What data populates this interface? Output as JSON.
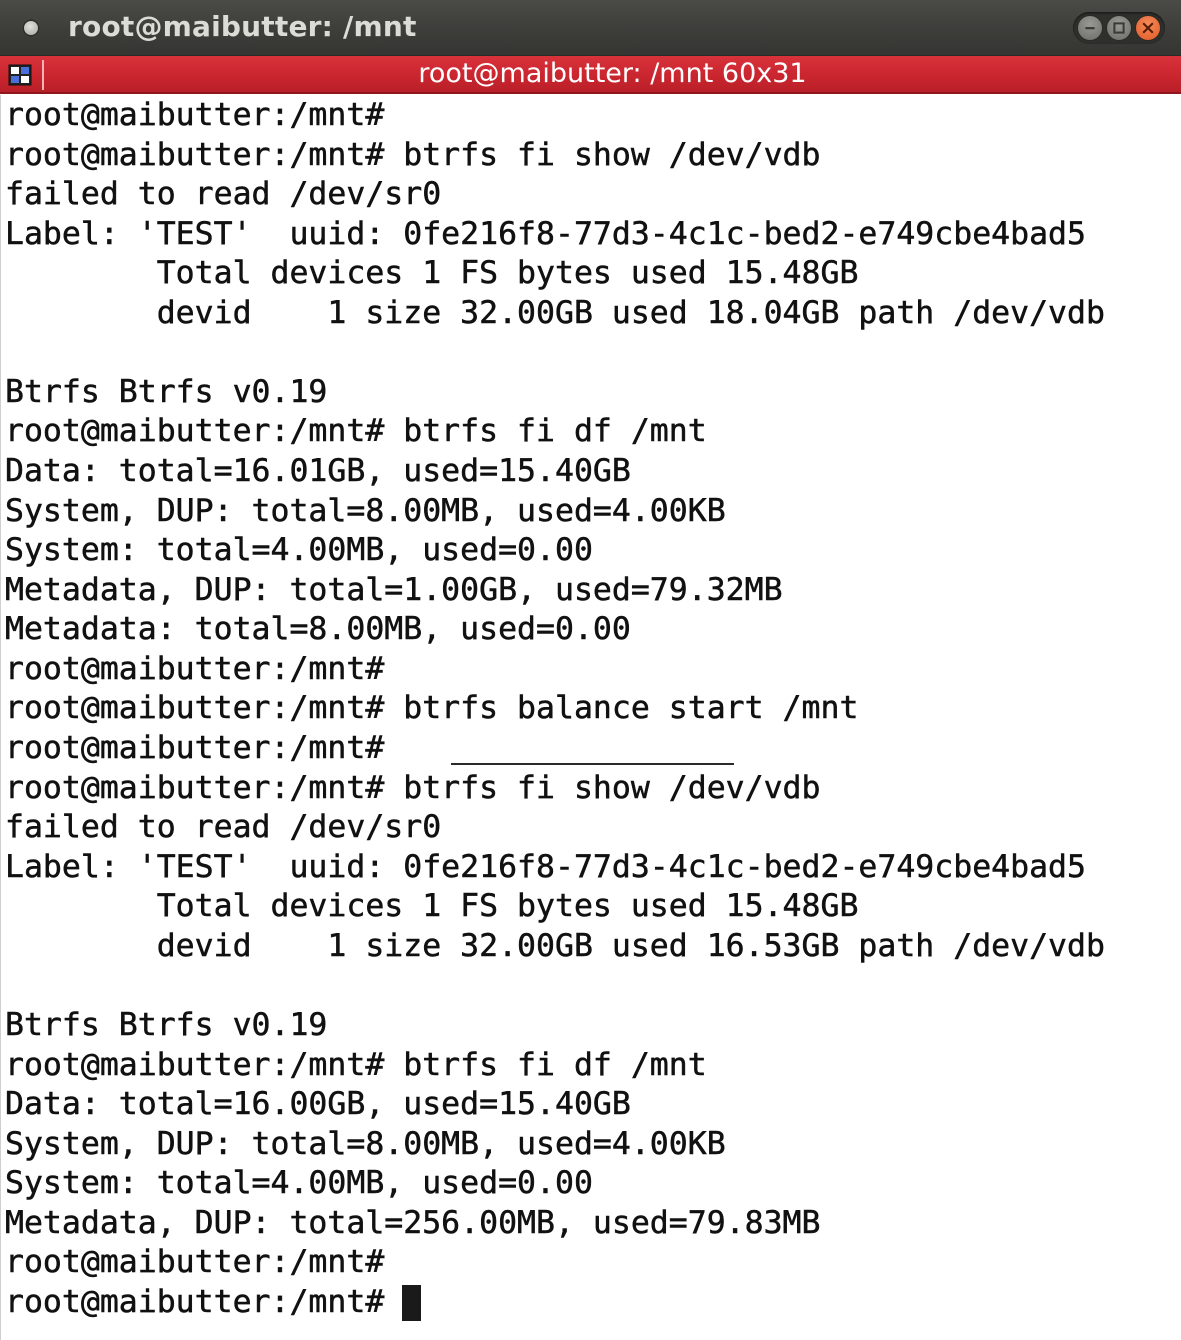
{
  "window": {
    "title": "root@maibutter: /mnt",
    "controls": [
      "minimize-icon",
      "maximize-icon",
      "close-icon"
    ],
    "colors": {
      "titlebar": "#3d3d3a",
      "tabbar": "#c9252e",
      "terminal_bg": "#ffffff",
      "terminal_fg": "#111111",
      "close_button": "#e05a26"
    }
  },
  "tab": {
    "icon": "terminal-tab-icon",
    "title": "root@maibutter: /mnt 60x31"
  },
  "terminal": {
    "lines": [
      "root@maibutter:/mnt#",
      "root@maibutter:/mnt# btrfs fi show /dev/vdb",
      "failed to read /dev/sr0",
      "Label: 'TEST'  uuid: 0fe216f8-77d3-4c1c-bed2-e749cbe4bad5",
      "        Total devices 1 FS bytes used 15.48GB",
      "        devid    1 size 32.00GB used 18.04GB path /dev/vdb",
      "",
      "Btrfs Btrfs v0.19",
      "root@maibutter:/mnt# btrfs fi df /mnt",
      "Data: total=16.01GB, used=15.40GB",
      "System, DUP: total=8.00MB, used=4.00KB",
      "System: total=4.00MB, used=0.00",
      "Metadata, DUP: total=1.00GB, used=79.32MB",
      "Metadata: total=8.00MB, used=0.00",
      "root@maibutter:/mnt#",
      "root@maibutter:/mnt# btrfs balance start /mnt",
      "root@maibutter:/mnt#",
      "root@maibutter:/mnt# btrfs fi show /dev/vdb",
      "failed to read /dev/sr0",
      "Label: 'TEST'  uuid: 0fe216f8-77d3-4c1c-bed2-e749cbe4bad5",
      "        Total devices 1 FS bytes used 15.48GB",
      "        devid    1 size 32.00GB used 16.53GB path /dev/vdb",
      "",
      "Btrfs Btrfs v0.19",
      "root@maibutter:/mnt# btrfs fi df /mnt",
      "Data: total=16.00GB, used=15.40GB",
      "System, DUP: total=8.00MB, used=4.00KB",
      "System: total=4.00MB, used=0.00",
      "Metadata, DUP: total=256.00MB, used=79.83MB",
      "root@maibutter:/mnt#",
      "root@maibutter:/mnt# "
    ]
  }
}
